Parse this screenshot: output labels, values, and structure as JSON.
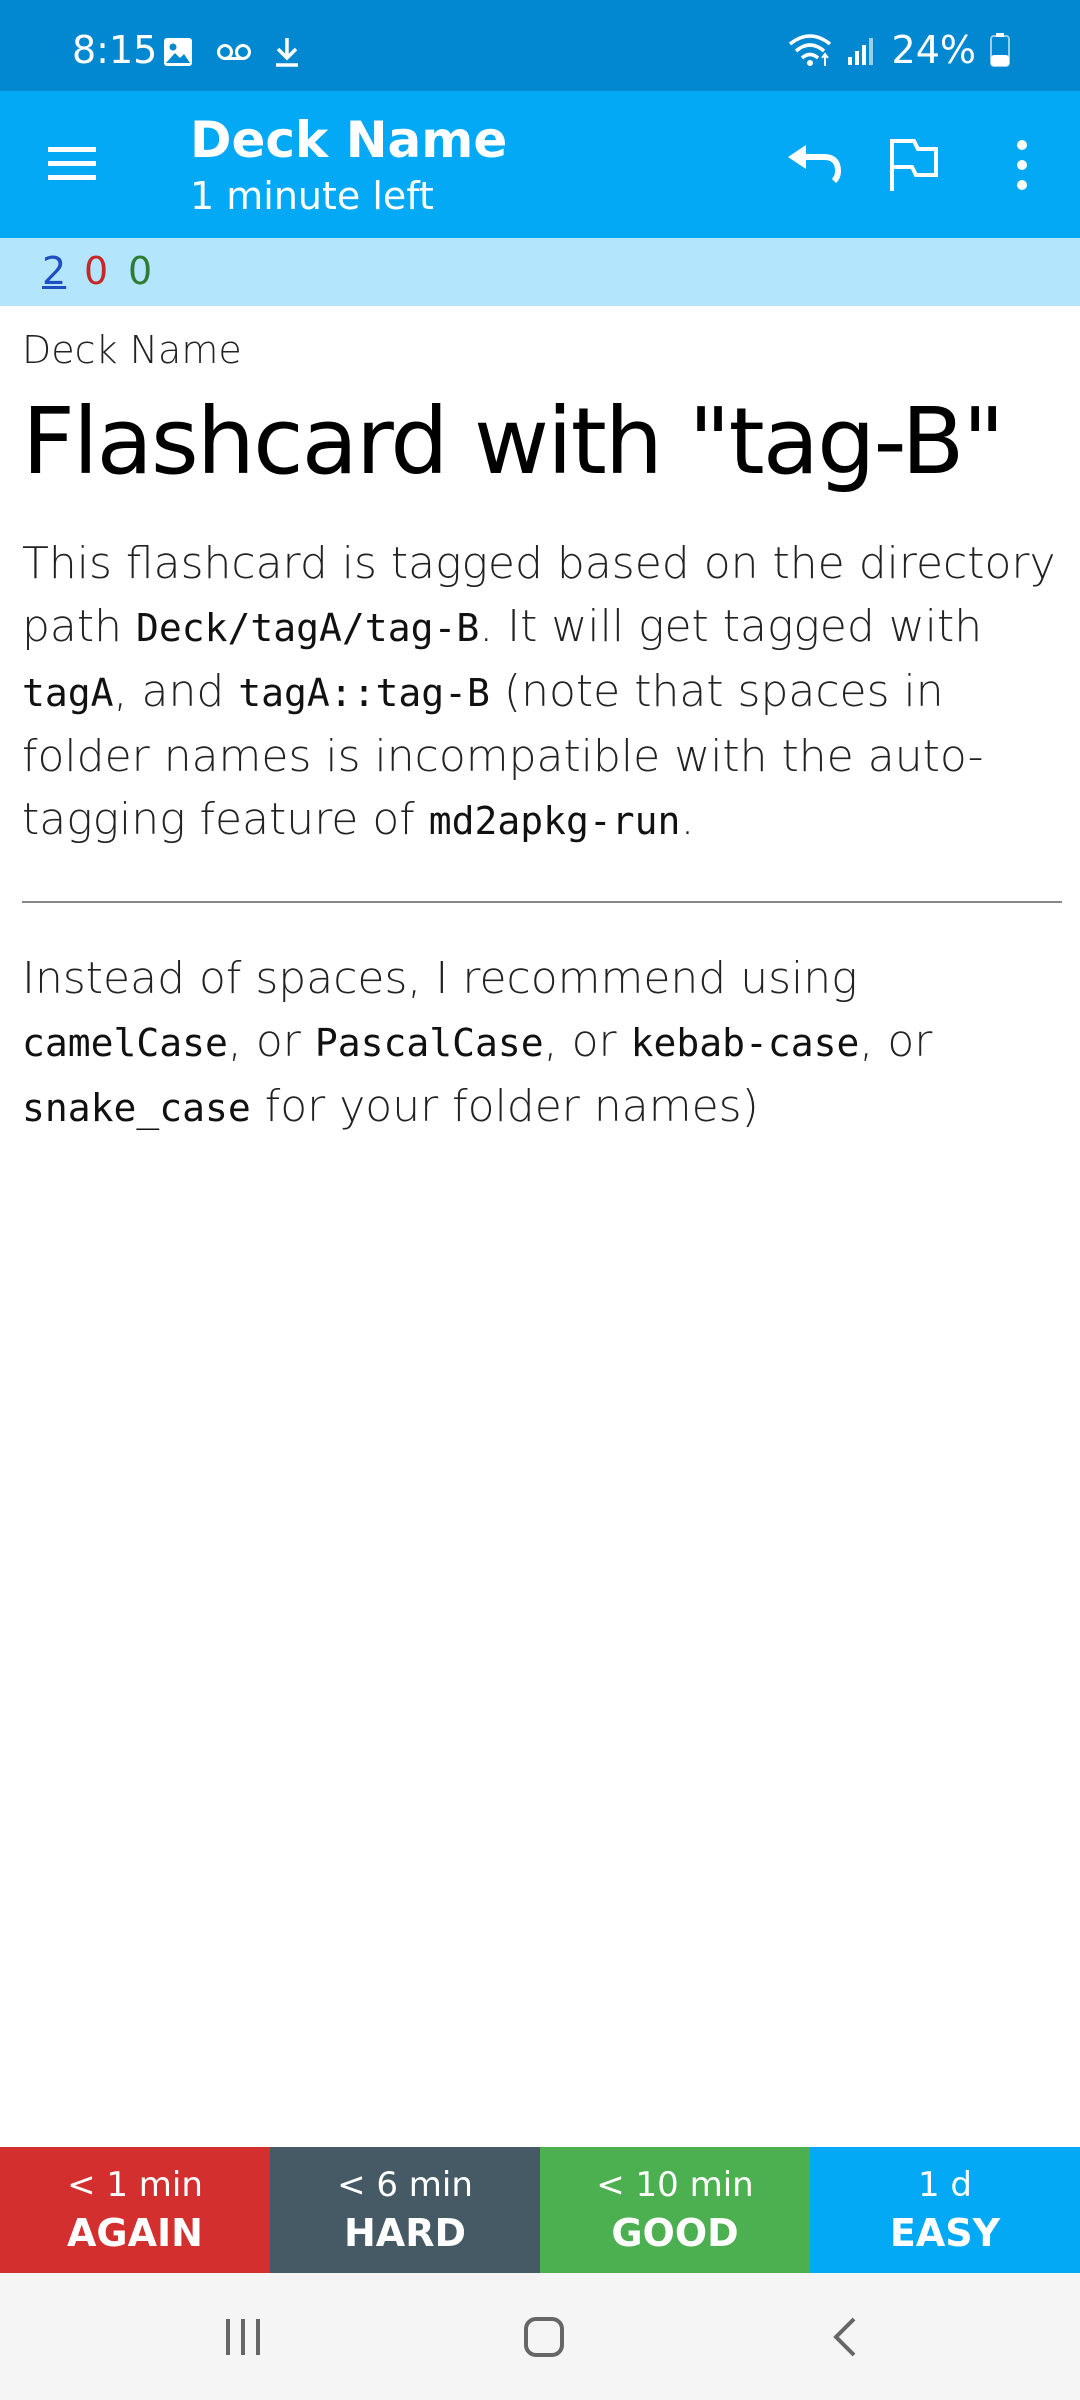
{
  "status_bar": {
    "time": "8:15",
    "battery": "24%",
    "icons": [
      "gallery-icon",
      "voicemail-icon",
      "download-icon",
      "wifi-icon",
      "signal-icon",
      "battery-icon"
    ]
  },
  "app_bar": {
    "title": "Deck Name",
    "subtitle": "1 minute left",
    "icons": [
      "menu-icon",
      "undo-icon",
      "flag-icon",
      "more-vert-icon"
    ]
  },
  "counts": {
    "new": "2",
    "learning": "0",
    "review": "0",
    "colors": {
      "new": "#1e4fc2",
      "learning": "#c62828",
      "review": "#2e7d32"
    }
  },
  "card": {
    "deck_label": "Deck Name",
    "title": "Flashcard with \"tag-B\"",
    "para1": {
      "t1": "This flashcard is tagged based on the directory path ",
      "c1": "Deck/tagA/tag-B",
      "t2": ". It will get tagged with ",
      "c2": "tagA",
      "t3": ", and ",
      "c3": "tagA::tag-B",
      "t4": " (note that spaces in folder names is incompatible with the auto-tagging feature of ",
      "c4": "md2apkg-run",
      "t5": "."
    },
    "para2": {
      "t1": "Instead of spaces, I recommend using ",
      "c1": "camelCase",
      "t2": ", or ",
      "c2": "PascalCase",
      "t3": ", or ",
      "c3": "kebab-case",
      "t4": ", or ",
      "c4": "snake_case",
      "t5": " for your folder names)"
    }
  },
  "answers": [
    {
      "time": "< 1 min",
      "label": "AGAIN",
      "color": "#d32f2f"
    },
    {
      "time": "< 6 min",
      "label": "HARD",
      "color": "#455a64"
    },
    {
      "time": "< 10 min",
      "label": "GOOD",
      "color": "#4caf50"
    },
    {
      "time": "1 d",
      "label": "EASY",
      "color": "#03a9f4"
    }
  ],
  "nav_bar": {
    "icons": [
      "recent-apps-icon",
      "home-icon",
      "back-icon"
    ]
  }
}
